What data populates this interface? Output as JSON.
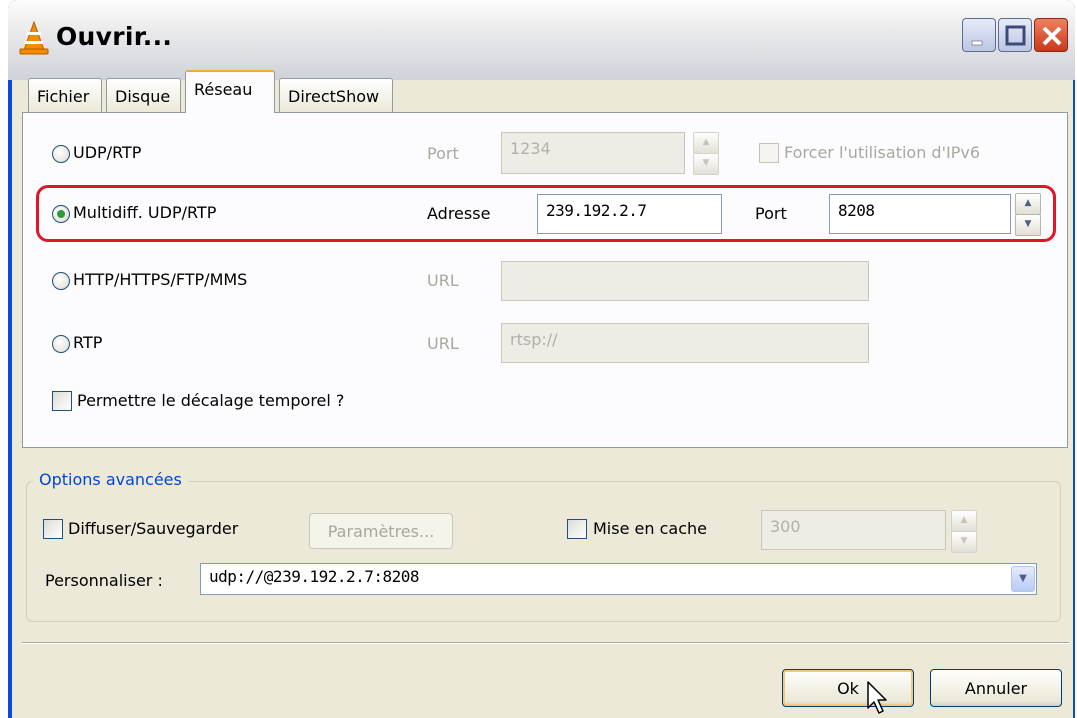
{
  "window": {
    "title": "Ouvrir...",
    "icon": "vlc-cone-icon",
    "controls": [
      "minimize-icon",
      "maximize-icon",
      "close-icon"
    ]
  },
  "tabs": [
    {
      "label": "Fichier",
      "active": false
    },
    {
      "label": "Disque",
      "active": false
    },
    {
      "label": "Réseau",
      "active": true
    },
    {
      "label": "DirectShow",
      "active": false
    }
  ],
  "network": {
    "udp": {
      "label": "UDP/RTP",
      "port_label": "Port",
      "port_value": "1234",
      "ipv6_label": "Forcer l'utilisation d'IPv6",
      "selected": false
    },
    "multicast": {
      "label": "Multidiff. UDP/RTP",
      "address_label": "Adresse",
      "address_value": "239.192.2.7",
      "port_label": "Port",
      "port_value": "8208",
      "selected": true
    },
    "http": {
      "label": "HTTP/HTTPS/FTP/MMS",
      "url_label": "URL",
      "url_value": "",
      "selected": false
    },
    "rtp": {
      "label": "RTP",
      "url_label": "URL",
      "url_value": "rtsp://",
      "selected": false
    },
    "timeshift": {
      "label": "Permettre le décalage temporel ?",
      "checked": false
    }
  },
  "advanced": {
    "legend": "Options avancées",
    "stream_label": "Diffuser/Sauvegarder",
    "params_button": "Paramètres...",
    "cache_label": "Mise en cache",
    "cache_value": "300",
    "custom_label": "Personnaliser :",
    "custom_value": "udp://@239.192.2.7:8208"
  },
  "buttons": {
    "ok": "Ok",
    "cancel": "Annuler"
  },
  "colors": {
    "highlight": "#e0142a",
    "accent_tab": "#f5a73a",
    "legend": "#0046d5"
  }
}
